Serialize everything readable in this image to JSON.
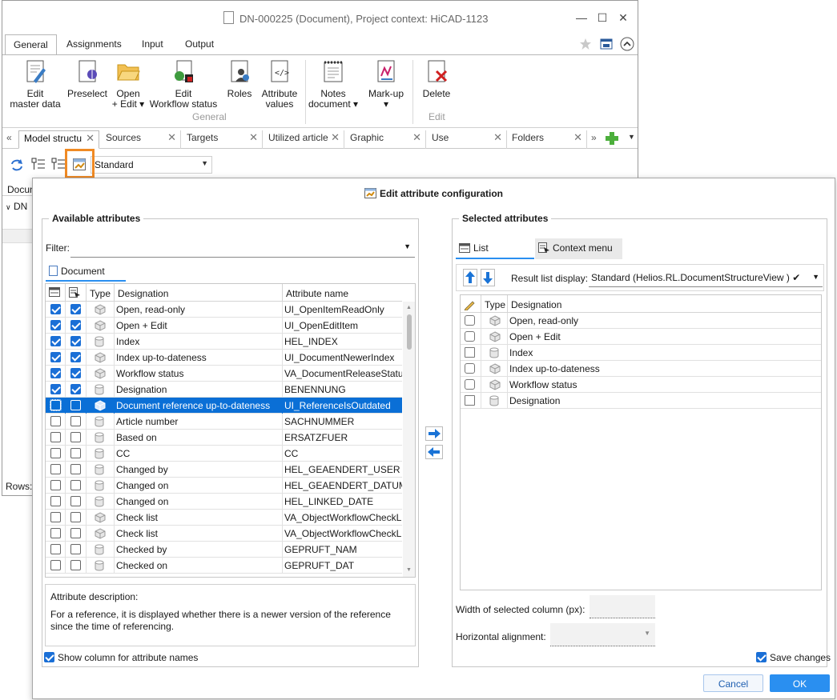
{
  "window": {
    "title": "DN-000225 (Document), Project context: HiCAD-1123",
    "ribbon_tabs": [
      "General",
      "Assignments",
      "Input",
      "Output"
    ],
    "ribbon_buttons": {
      "edit_master_data": "Edit\nmaster data",
      "preselect": "Preselect",
      "open_edit": "Open\n+ Edit ▾",
      "edit_workflow": "Edit\nWorkflow status",
      "roles": "Roles",
      "attribute_values": "Attribute\nvalues",
      "notes_document": "Notes\ndocument ▾",
      "markup": "Mark-up\n▾",
      "delete": "Delete"
    },
    "group_labels": {
      "general": "General",
      "edit": "Edit"
    },
    "doc_tabs": [
      "Model structu",
      "Sources",
      "Targets",
      "Utilized article",
      "Graphic",
      "Use",
      "Folders"
    ],
    "toolbar_combo": "Standard",
    "left_column_header": "Docun",
    "left_row_label": "DN",
    "rows_label": "Rows:"
  },
  "dialog": {
    "title": "Edit attribute configuration",
    "available": {
      "title": "Available attributes",
      "filter_label": "Filter:",
      "filter_value": "",
      "tab": "Document",
      "columns": [
        "Type",
        "Designation",
        "Attribute name"
      ],
      "rows": [
        {
          "c1": true,
          "c2": true,
          "icon": "cube",
          "designation": "Open, read-only",
          "attr": "UI_OpenItemReadOnly"
        },
        {
          "c1": true,
          "c2": true,
          "icon": "cube",
          "designation": "Open + Edit",
          "attr": "UI_OpenEditItem"
        },
        {
          "c1": true,
          "c2": true,
          "icon": "cylinder",
          "designation": "Index",
          "attr": "HEL_INDEX"
        },
        {
          "c1": true,
          "c2": true,
          "icon": "cube",
          "designation": "Index up-to-dateness",
          "attr": "UI_DocumentNewerIndex"
        },
        {
          "c1": true,
          "c2": true,
          "icon": "cube",
          "designation": "Workflow status",
          "attr": "VA_DocumentReleaseStatus"
        },
        {
          "c1": true,
          "c2": true,
          "icon": "cylinder",
          "designation": "Designation",
          "attr": "BENENNUNG"
        },
        {
          "c1": false,
          "c2": false,
          "icon": "cube",
          "designation": "Document reference up-to-dateness",
          "attr": "UI_ReferenceIsOutdated",
          "selected": true
        },
        {
          "c1": false,
          "c2": false,
          "icon": "cylinder",
          "designation": "Article number",
          "attr": "SACHNUMMER"
        },
        {
          "c1": false,
          "c2": false,
          "icon": "cylinder",
          "designation": "Based on",
          "attr": "ERSATZFUER"
        },
        {
          "c1": false,
          "c2": false,
          "icon": "cylinder",
          "designation": "CC",
          "attr": "CC"
        },
        {
          "c1": false,
          "c2": false,
          "icon": "cylinder",
          "designation": "Changed by",
          "attr": "HEL_GEAENDERT_USER"
        },
        {
          "c1": false,
          "c2": false,
          "icon": "cylinder",
          "designation": "Changed on",
          "attr": "HEL_GEAENDERT_DATUM"
        },
        {
          "c1": false,
          "c2": false,
          "icon": "cylinder",
          "designation": "Changed on",
          "attr": "HEL_LINKED_DATE"
        },
        {
          "c1": false,
          "c2": false,
          "icon": "cube",
          "designation": "Check list",
          "attr": "VA_ObjectWorkflowCheckL"
        },
        {
          "c1": false,
          "c2": false,
          "icon": "cube",
          "designation": "Check list",
          "attr": "VA_ObjectWorkflowCheckL"
        },
        {
          "c1": false,
          "c2": false,
          "icon": "cylinder",
          "designation": "Checked by",
          "attr": "GEPRUFT_NAM"
        },
        {
          "c1": false,
          "c2": false,
          "icon": "cylinder",
          "designation": "Checked on",
          "attr": "GEPRUFT_DAT"
        }
      ],
      "description_label": "Attribute description:",
      "description_text": "For a reference, it is displayed whether there is a newer version of the reference since the time of referencing.",
      "show_column_label": "Show column for attribute names",
      "show_column_checked": true
    },
    "selected": {
      "title": "Selected attributes",
      "tabs": [
        "List",
        "Context menu"
      ],
      "result_list_label": "Result list display:",
      "result_list_value": "Standard (Helios.RL.DocumentStructureView ) ✔",
      "columns": [
        "Type",
        "Designation"
      ],
      "rows": [
        {
          "icon": "cube",
          "designation": "Open, read-only",
          "box": "rounded"
        },
        {
          "icon": "cube",
          "designation": "Open + Edit",
          "box": "rounded"
        },
        {
          "icon": "cylinder",
          "designation": "Index",
          "box": "square"
        },
        {
          "icon": "cube",
          "designation": "Index up-to-dateness",
          "box": "rounded"
        },
        {
          "icon": "cube",
          "designation": "Workflow status",
          "box": "rounded"
        },
        {
          "icon": "cylinder",
          "designation": "Designation",
          "box": "square"
        }
      ],
      "width_label": "Width of selected column (px):",
      "width_value": "",
      "alignment_label": "Horizontal alignment:",
      "alignment_value": "",
      "save_changes_label": "Save changes",
      "save_changes_checked": true
    },
    "buttons": {
      "cancel": "Cancel",
      "ok": "OK"
    }
  }
}
